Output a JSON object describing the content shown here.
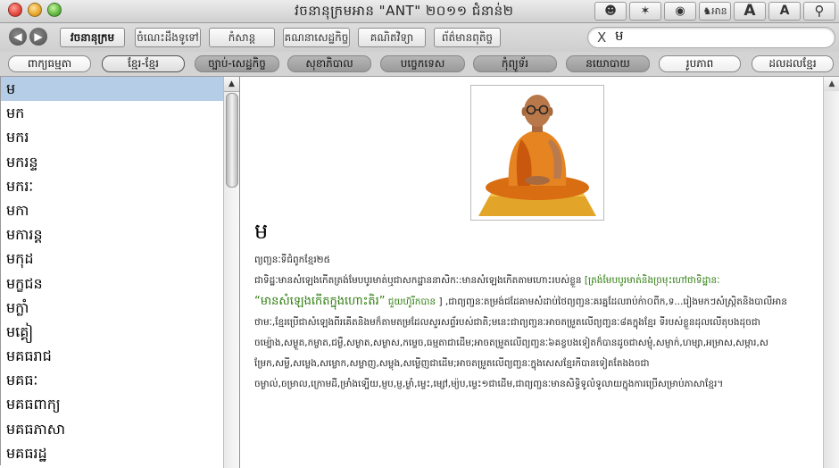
{
  "window": {
    "title": "វចនានុក្រមអាន \"ANT\" ២០១១ ជំនាន់២"
  },
  "title_icons": [
    {
      "name": "monk-portrait-icon",
      "label": "",
      "glyph": "☻"
    },
    {
      "name": "mosquito-icon",
      "label": "",
      "glyph": "✶"
    },
    {
      "name": "speaker-icon",
      "label": "",
      "glyph": "◉"
    },
    {
      "name": "read-icon",
      "label": "អាន",
      "glyph": "♞"
    },
    {
      "name": "font-larger-icon",
      "label": "A",
      "glyph": ""
    },
    {
      "name": "font-smaller-icon",
      "label": "A",
      "glyph": ""
    },
    {
      "name": "magnifier-icon",
      "label": "",
      "glyph": "⚲"
    }
  ],
  "toolbar": {
    "back_glyph": "◀",
    "forward_glyph": "▶",
    "tabs": [
      {
        "label": "វចនានុក្រម",
        "active": true
      },
      {
        "label": "ចំណេះដឹងទូទៅ",
        "active": false
      },
      {
        "label": "កំសាន្ត",
        "active": false
      },
      {
        "label": "គណនាសេដ្ឋកិច្ច",
        "active": false
      },
      {
        "label": "គណិតវិទ្យា",
        "active": false
      },
      {
        "label": "ព័ត៌មានពុតិច្ច",
        "active": false
      }
    ]
  },
  "search": {
    "clear_glyph": "X",
    "value": "ម"
  },
  "categories": [
    {
      "label": "ពាក្យធម្មតា",
      "style": "light"
    },
    {
      "label": "ខ្មែរ-ខ្មែរ",
      "style": "sel"
    },
    {
      "label": "ច្បាប់-សេដ្ឋកិច្ច",
      "style": "dark"
    },
    {
      "label": "សុខាភិបាល",
      "style": "dark"
    },
    {
      "label": "បច្ចេកទេស",
      "style": "dark"
    },
    {
      "label": "កុំព្យូទ័រ",
      "style": "dark"
    },
    {
      "label": "នយោបាយ",
      "style": "dark"
    },
    {
      "label": "រូបភាព",
      "style": "light"
    },
    {
      "label": "ដលដលខ្មែរ",
      "style": "light"
    }
  ],
  "word_list": [
    "ម",
    "មក",
    "មករ",
    "មករន្ទ",
    "មករៈ",
    "មកា",
    "មការន្ត",
    "មកុដ",
    "មក្ខជន",
    "មក្លាំ",
    "មគ្គៀ",
    "មគធរាជ",
    "មគធៈ",
    "មគធពាក្យ",
    "មគធភាសា",
    "មគធរដ្ឋ"
  ],
  "entry": {
    "headword": "ម",
    "pos_line": "ព្យញ្ជនៈទីជំពូកខ្មែរ២៥",
    "def_intro": "ជាទិដ្ឋៈមានសំឡេងកើតត្រង់មែបបូរមាត់ឬជាសកដ្ឋាននាសិកៈ:មានសំឡេងកើតតាមហោះរបស់ខ្លួន",
    "def_green": "[ត្រង់មែបបូរមាត់និងច្រមុះហៅថាទិដ្ឋានៈ",
    "def_quote": "“មានសំឡេងកើតក្នុងហោះតិរ”",
    "def_green2": "ជួយហ៊ូរីកបាន",
    "def_rest": "] ,ជាព្យញ្ជនៈតម្រង់ជដែគាមសំដាប់ថៃព្យញ្ជនៈគរគ្នដែលរាប់ក់ា០ពីក,ទ...រៀងមកៗសំស្រ្កិតនិងបាលីអានថាមៈ,ខ្មែរប្រើជាសំឡេងពីរគើតនិងមក៏តាមតម្រដែលសួរសព្ទ័របស់ជាតិ;មនេះជាព្យញ្ជនៈអាចតម្រួតលើព្យញ្ជនៈ៨គក្នុងខ្មែរ ទីរបស់ខ្លួនដុលលើតុបងដុចជាចម្ប៉ោង,សម្ងួត,កម្ចាត,ជម្ងឺ,សម្ងាត,សម្ងាស,កម្ទេច,ធម្មតាជាដើម;អាចតម្រួតលើព្យញ្ជនៈ៦គខ្វបងទៀតក៏បានដូចជាសម្ញុំ,សម្ញាក់,ហម្សា,អម្រាស,សម្ភារ,សម្រែក,សម្លី,សម្លេង,សម្លោក,សម្លាញ,សម្លុង,សម្លើញជាដើម;អាចតម្រួតលើព្យញ្ជនៈក្នុងសេសខ្មែរកីបានទៀតតែងងចជាចម្ងាល់,ចម្រាល,ក្រោមដី,ម្រាំងទ្បើយ,ម្ញប,ម្ញ,ម្ងាំ,ម្ទេះ,ម្សៅ,ម្យ៉ប,ម្ទេះ១ជាដើម,ជាព្យញ្ជនៈមានសិទ្ធិទូលំទូលាយក្នុងការប្រើសម្រាប់ភាសាខ្មែរ។"
  },
  "colors": {
    "selection": "#b5cde7",
    "link_green": "#2b7a0b",
    "robe": "#e07a1c"
  }
}
